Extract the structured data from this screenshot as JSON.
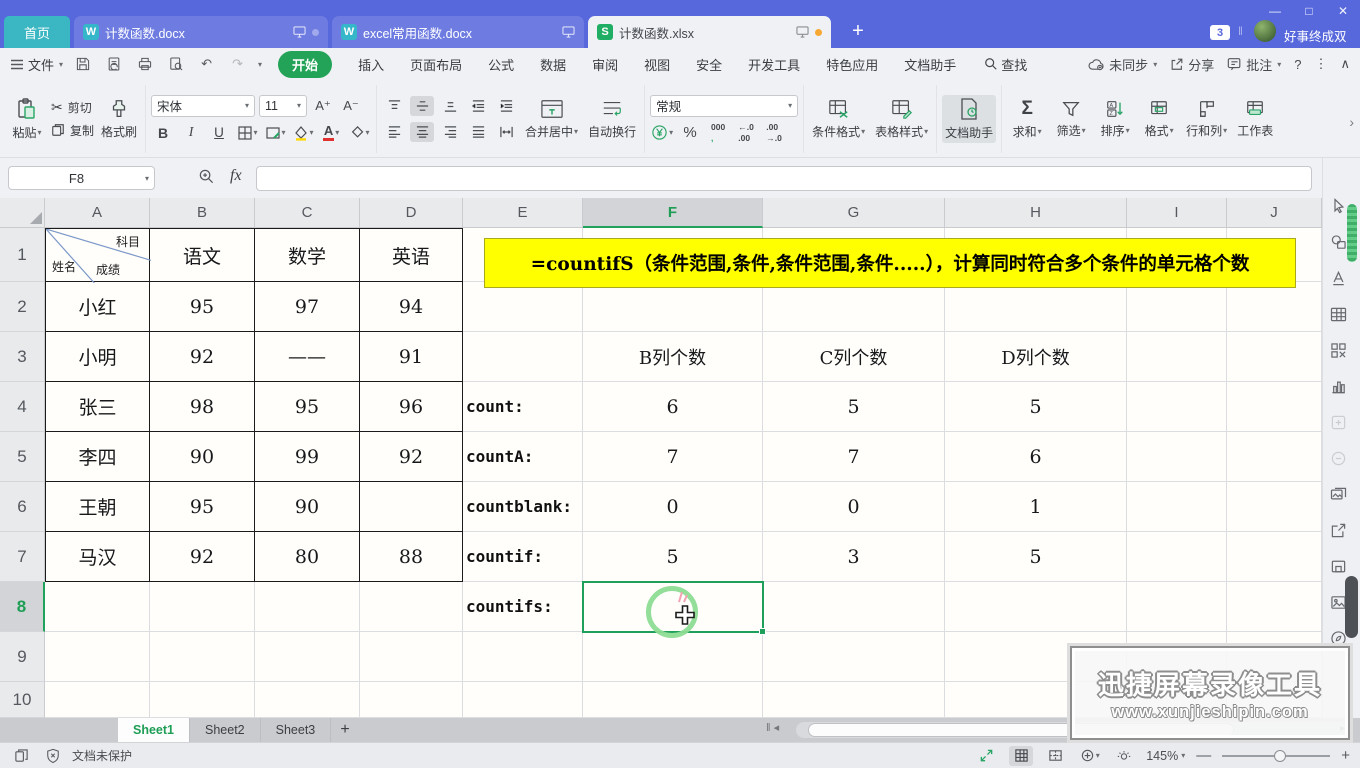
{
  "titlebar": {
    "home": "首页",
    "documents": [
      {
        "name": "计数函数.docx",
        "app": "wps-writer"
      },
      {
        "name": "excel常用函数.docx",
        "app": "wps-writer"
      },
      {
        "name": "计数函数.xlsx",
        "app": "wps-spreadsheet"
      }
    ],
    "active_document": "计数函数.xlsx",
    "message_count": "3",
    "username": "好事终成双"
  },
  "menubar": {
    "file": "文件",
    "tabs": [
      "开始",
      "插入",
      "页面布局",
      "公式",
      "数据",
      "审阅",
      "视图",
      "安全",
      "开发工具",
      "特色应用",
      "文档助手"
    ],
    "active_tab": "开始",
    "search": "查找",
    "sync": "未同步",
    "share": "分享",
    "comment": "批注"
  },
  "ribbon": {
    "paste": "粘贴",
    "cut": "剪切",
    "copy": "复制",
    "format_painter": "格式刷",
    "font_name": "宋体",
    "font_size": "11",
    "merge_center": "合并居中",
    "wrap_text": "自动换行",
    "number_format": "常规",
    "conditional_format": "条件格式",
    "table_style": "表格样式",
    "doc_assistant": "文档助手",
    "sum": "求和",
    "filter": "筛选",
    "sort": "排序",
    "format": "格式",
    "rows_cols": "行和列",
    "worksheet": "工作表"
  },
  "formula_bar": {
    "cell_reference": "F8",
    "fx_label": "fx",
    "formula": ""
  },
  "grid": {
    "column_headers": [
      "A",
      "B",
      "C",
      "D",
      "E",
      "F",
      "G",
      "H",
      "I",
      "J"
    ],
    "row_headers": [
      "1",
      "2",
      "3",
      "4",
      "5",
      "6",
      "7",
      "8",
      "9",
      "10"
    ],
    "selected_cell": "F8",
    "selected_column": "F",
    "selected_row": "8",
    "corner_cell": {
      "subject": "科目",
      "name": "姓名",
      "score": "成绩"
    },
    "subject_columns": [
      "语文",
      "数学",
      "英语"
    ],
    "students": [
      [
        "小红",
        "95",
        "97",
        "94"
      ],
      [
        "小明",
        "92",
        "——",
        "91"
      ],
      [
        "张三",
        "98",
        "95",
        "96"
      ],
      [
        "李四",
        "90",
        "99",
        "92"
      ],
      [
        "王朝",
        "95",
        "90",
        ""
      ],
      [
        "马汉",
        "92",
        "80",
        "88"
      ]
    ],
    "count_titles": [
      "B列个数",
      "C列个数",
      "D列个数"
    ],
    "count_rows": [
      [
        "count:",
        "6",
        "5",
        "5"
      ],
      [
        "countA:",
        "7",
        "7",
        "6"
      ],
      [
        "countblank:",
        "0",
        "0",
        "1"
      ],
      [
        "countif:",
        "5",
        "3",
        "5"
      ],
      [
        "countifs:",
        "",
        "",
        ""
      ]
    ],
    "banner": "=countifS（条件范围,条件,条件范围,条件.....），计算同时符合多个条件的单元格个数"
  },
  "sheetbar": {
    "tabs": [
      "Sheet1",
      "Sheet2",
      "Sheet3"
    ],
    "active_tab": "Sheet1"
  },
  "statusbar": {
    "protection": "文档未保护",
    "zoom_level": "145%"
  },
  "watermark": {
    "title": "迅捷屏幕录像工具",
    "url": "www.xunjieshipin.com"
  },
  "sidebar_icons": [
    "cursor-icon",
    "shapes-icon",
    "wordart-icon",
    "table-icon",
    "grid-icon",
    "chart-icon",
    "tool-faded-1-icon",
    "tool-faded-2-icon",
    "gallery-icon",
    "export-icon",
    "clipboard-panel-icon",
    "image-icon",
    "eco-icon"
  ]
}
